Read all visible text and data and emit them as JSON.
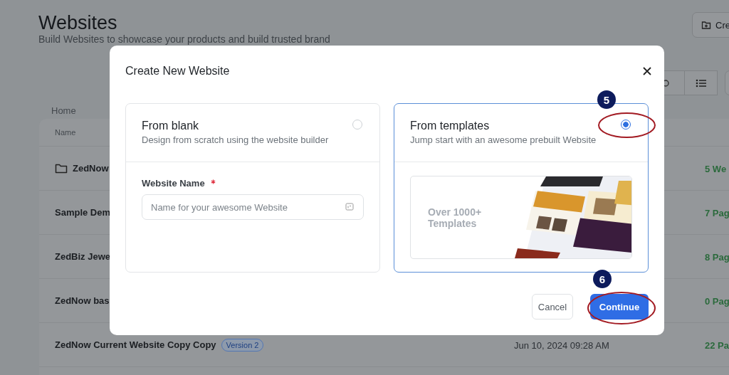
{
  "page": {
    "title": "Websites",
    "subtitle": "Build Websites to showcase your products and build trusted brand",
    "create_button": "Cre"
  },
  "breadcrumb": "Home",
  "table": {
    "columns": [
      "Name"
    ],
    "rows": [
      {
        "kind": "folder",
        "name": "ZedNow",
        "pages": "5 We"
      },
      {
        "kind": "site",
        "name": "Sample Dem",
        "pages": "7 Pag"
      },
      {
        "kind": "site",
        "name": "ZedBiz Jewe",
        "pages": "8 Pag"
      },
      {
        "kind": "site",
        "name": "ZedNow bas",
        "pages": "0 Pag"
      },
      {
        "kind": "site",
        "name": "ZedNow Current Website Copy Copy",
        "badge": "Version 2",
        "date": "Jun 10, 2024 09:28 AM",
        "pages": "22 Pa"
      }
    ]
  },
  "dialog": {
    "title": "Create New Website",
    "options": [
      {
        "kind": "form",
        "title": "From blank",
        "description": "Design from scratch using the website builder",
        "selected": false
      },
      {
        "kind": "preview",
        "title": "From templates",
        "description": "Jump start with an awesome prebuilt Website",
        "selected": true,
        "annotation": "5",
        "preview_text": "Over 1000+ Templates"
      }
    ],
    "field": {
      "label": "Website Name",
      "required": true,
      "placeholder": "Name for your awesome Website"
    },
    "buttons": [
      {
        "kind": "secondary",
        "label": "Cancel"
      },
      {
        "kind": "primary",
        "label": "Continue",
        "annotation": "6"
      }
    ]
  }
}
